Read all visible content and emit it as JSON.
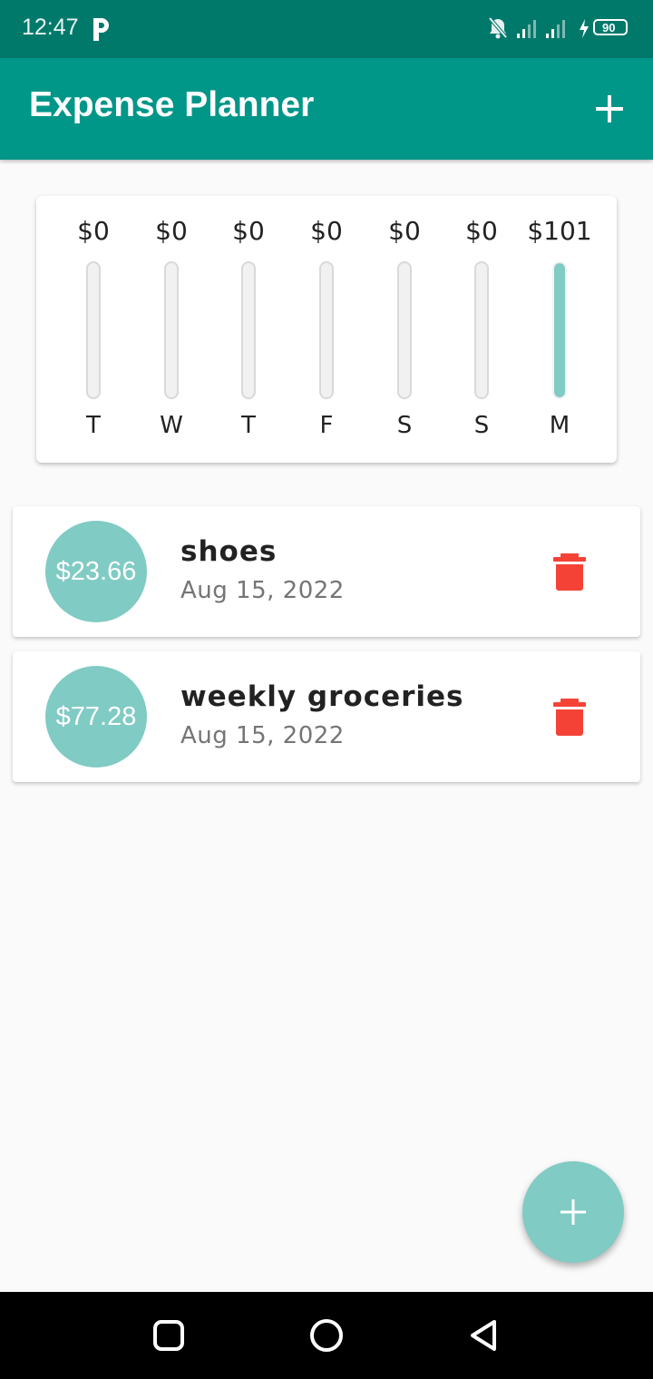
{
  "status_bar": {
    "time": "12:47",
    "battery": "90",
    "icons": [
      "parking-app-icon",
      "bell-off-icon",
      "signal-icon",
      "signal-icon",
      "charging-icon",
      "battery-icon"
    ]
  },
  "app_bar": {
    "title": "Expense Planner",
    "add_icon": "plus-icon"
  },
  "chart": {
    "days": [
      {
        "day": "T",
        "amount": "$0",
        "fraction": 0
      },
      {
        "day": "W",
        "amount": "$0",
        "fraction": 0
      },
      {
        "day": "T",
        "amount": "$0",
        "fraction": 0
      },
      {
        "day": "F",
        "amount": "$0",
        "fraction": 0
      },
      {
        "day": "S",
        "amount": "$0",
        "fraction": 0
      },
      {
        "day": "S",
        "amount": "$0",
        "fraction": 0
      },
      {
        "day": "M",
        "amount": "$101",
        "fraction": 1
      }
    ],
    "fill_color": "#80cbc4"
  },
  "transactions": [
    {
      "amount": "$23.66",
      "title": "shoes",
      "date": "Aug 15, 2022"
    },
    {
      "amount": "$77.28",
      "title": "weekly groceries",
      "date": "Aug 15, 2022"
    }
  ],
  "colors": {
    "primary": "#009688",
    "primary_dark": "#00796b",
    "accent": "#80cbc4",
    "delete": "#f44336"
  },
  "fab": {
    "icon": "plus-icon"
  },
  "nav_bar": {
    "icons": [
      "recents-square-icon",
      "home-circle-icon",
      "back-triangle-icon"
    ]
  }
}
